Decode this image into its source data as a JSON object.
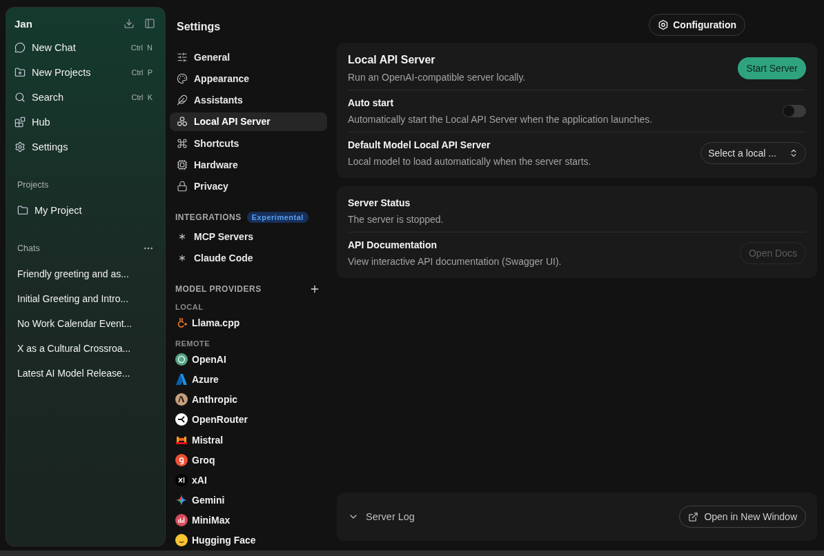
{
  "app": {
    "title": "Jan"
  },
  "sidebar": {
    "items": [
      {
        "label": "New Chat",
        "shortcut": "Ctrl  N"
      },
      {
        "label": "New Projects",
        "shortcut": "Ctrl  P"
      },
      {
        "label": "Search",
        "shortcut": "Ctrl  K"
      },
      {
        "label": "Hub"
      },
      {
        "label": "Settings"
      }
    ],
    "projects": {
      "heading": "Projects",
      "items": [
        "My Project"
      ]
    },
    "chats": {
      "heading": "Chats",
      "items": [
        "Friendly greeting and as...",
        "Initial Greeting and Intro...",
        "No Work Calendar Event...",
        "X as a Cultural Crossroa...",
        "Latest AI Model Release..."
      ]
    }
  },
  "settings_nav": {
    "title": "Settings",
    "items": [
      {
        "label": "General",
        "selected": false
      },
      {
        "label": "Appearance",
        "selected": false
      },
      {
        "label": "Assistants",
        "selected": false
      },
      {
        "label": "Local API Server",
        "selected": true
      },
      {
        "label": "Shortcuts",
        "selected": false
      },
      {
        "label": "Hardware",
        "selected": false
      },
      {
        "label": "Privacy",
        "selected": false
      }
    ],
    "integrations": {
      "heading": "INTEGRATIONS",
      "badge": "Experimental",
      "items": [
        "MCP Servers",
        "Claude Code"
      ]
    },
    "providers": {
      "heading": "MODEL PROVIDERS",
      "local_heading": "LOCAL",
      "local": [
        "Llama.cpp"
      ],
      "remote_heading": "REMOTE",
      "remote": [
        "OpenAI",
        "Azure",
        "Anthropic",
        "OpenRouter",
        "Mistral",
        "Groq",
        "xAI",
        "Gemini",
        "MiniMax",
        "Hugging Face"
      ]
    }
  },
  "header": {
    "button": "Configuration"
  },
  "server_card": {
    "title": "Local API Server",
    "description": "Run an OpenAI-compatible server locally.",
    "button": "Start Server",
    "auto_start": {
      "title": "Auto start",
      "description": "Automatically start the Local API Server when the application launches.",
      "on": false
    },
    "default_model": {
      "title": "Default Model Local API Server",
      "description": "Local model to load automatically when the server starts.",
      "select": "Select a local ..."
    }
  },
  "status_card": {
    "status": {
      "title": "Server Status",
      "description": "The server is stopped."
    },
    "docs": {
      "title": "API Documentation",
      "description": "View interactive API documentation (Swagger UI).",
      "button": "Open Docs",
      "disabled": true
    }
  },
  "log": {
    "title": "Server Log",
    "button": "Open in New Window"
  }
}
